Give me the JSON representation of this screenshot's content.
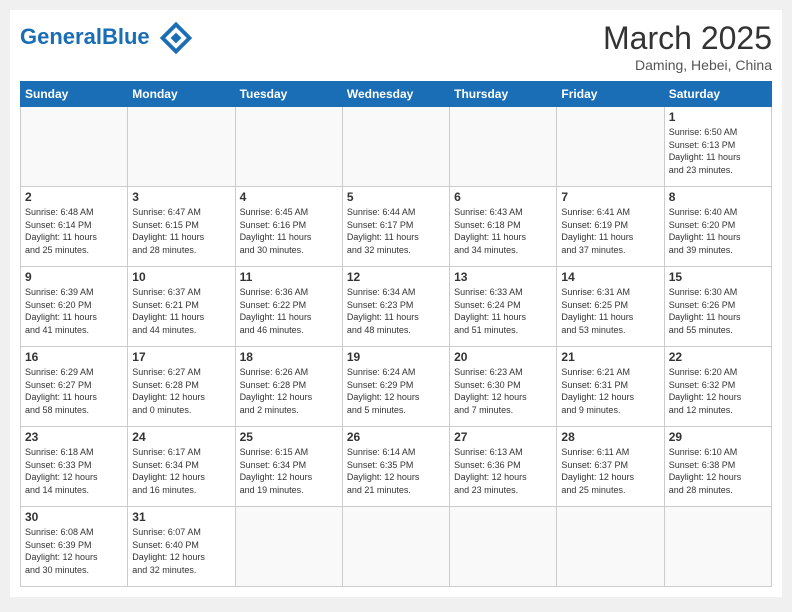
{
  "header": {
    "logo_general": "General",
    "logo_blue": "Blue",
    "month_title": "March 2025",
    "location": "Daming, Hebei, China"
  },
  "weekdays": [
    "Sunday",
    "Monday",
    "Tuesday",
    "Wednesday",
    "Thursday",
    "Friday",
    "Saturday"
  ],
  "weeks": [
    [
      {
        "day": "",
        "info": ""
      },
      {
        "day": "",
        "info": ""
      },
      {
        "day": "",
        "info": ""
      },
      {
        "day": "",
        "info": ""
      },
      {
        "day": "",
        "info": ""
      },
      {
        "day": "",
        "info": ""
      },
      {
        "day": "1",
        "info": "Sunrise: 6:50 AM\nSunset: 6:13 PM\nDaylight: 11 hours\nand 23 minutes."
      }
    ],
    [
      {
        "day": "2",
        "info": "Sunrise: 6:48 AM\nSunset: 6:14 PM\nDaylight: 11 hours\nand 25 minutes."
      },
      {
        "day": "3",
        "info": "Sunrise: 6:47 AM\nSunset: 6:15 PM\nDaylight: 11 hours\nand 28 minutes."
      },
      {
        "day": "4",
        "info": "Sunrise: 6:45 AM\nSunset: 6:16 PM\nDaylight: 11 hours\nand 30 minutes."
      },
      {
        "day": "5",
        "info": "Sunrise: 6:44 AM\nSunset: 6:17 PM\nDaylight: 11 hours\nand 32 minutes."
      },
      {
        "day": "6",
        "info": "Sunrise: 6:43 AM\nSunset: 6:18 PM\nDaylight: 11 hours\nand 34 minutes."
      },
      {
        "day": "7",
        "info": "Sunrise: 6:41 AM\nSunset: 6:19 PM\nDaylight: 11 hours\nand 37 minutes."
      },
      {
        "day": "8",
        "info": "Sunrise: 6:40 AM\nSunset: 6:20 PM\nDaylight: 11 hours\nand 39 minutes."
      }
    ],
    [
      {
        "day": "9",
        "info": "Sunrise: 6:39 AM\nSunset: 6:20 PM\nDaylight: 11 hours\nand 41 minutes."
      },
      {
        "day": "10",
        "info": "Sunrise: 6:37 AM\nSunset: 6:21 PM\nDaylight: 11 hours\nand 44 minutes."
      },
      {
        "day": "11",
        "info": "Sunrise: 6:36 AM\nSunset: 6:22 PM\nDaylight: 11 hours\nand 46 minutes."
      },
      {
        "day": "12",
        "info": "Sunrise: 6:34 AM\nSunset: 6:23 PM\nDaylight: 11 hours\nand 48 minutes."
      },
      {
        "day": "13",
        "info": "Sunrise: 6:33 AM\nSunset: 6:24 PM\nDaylight: 11 hours\nand 51 minutes."
      },
      {
        "day": "14",
        "info": "Sunrise: 6:31 AM\nSunset: 6:25 PM\nDaylight: 11 hours\nand 53 minutes."
      },
      {
        "day": "15",
        "info": "Sunrise: 6:30 AM\nSunset: 6:26 PM\nDaylight: 11 hours\nand 55 minutes."
      }
    ],
    [
      {
        "day": "16",
        "info": "Sunrise: 6:29 AM\nSunset: 6:27 PM\nDaylight: 11 hours\nand 58 minutes."
      },
      {
        "day": "17",
        "info": "Sunrise: 6:27 AM\nSunset: 6:28 PM\nDaylight: 12 hours\nand 0 minutes."
      },
      {
        "day": "18",
        "info": "Sunrise: 6:26 AM\nSunset: 6:28 PM\nDaylight: 12 hours\nand 2 minutes."
      },
      {
        "day": "19",
        "info": "Sunrise: 6:24 AM\nSunset: 6:29 PM\nDaylight: 12 hours\nand 5 minutes."
      },
      {
        "day": "20",
        "info": "Sunrise: 6:23 AM\nSunset: 6:30 PM\nDaylight: 12 hours\nand 7 minutes."
      },
      {
        "day": "21",
        "info": "Sunrise: 6:21 AM\nSunset: 6:31 PM\nDaylight: 12 hours\nand 9 minutes."
      },
      {
        "day": "22",
        "info": "Sunrise: 6:20 AM\nSunset: 6:32 PM\nDaylight: 12 hours\nand 12 minutes."
      }
    ],
    [
      {
        "day": "23",
        "info": "Sunrise: 6:18 AM\nSunset: 6:33 PM\nDaylight: 12 hours\nand 14 minutes."
      },
      {
        "day": "24",
        "info": "Sunrise: 6:17 AM\nSunset: 6:34 PM\nDaylight: 12 hours\nand 16 minutes."
      },
      {
        "day": "25",
        "info": "Sunrise: 6:15 AM\nSunset: 6:34 PM\nDaylight: 12 hours\nand 19 minutes."
      },
      {
        "day": "26",
        "info": "Sunrise: 6:14 AM\nSunset: 6:35 PM\nDaylight: 12 hours\nand 21 minutes."
      },
      {
        "day": "27",
        "info": "Sunrise: 6:13 AM\nSunset: 6:36 PM\nDaylight: 12 hours\nand 23 minutes."
      },
      {
        "day": "28",
        "info": "Sunrise: 6:11 AM\nSunset: 6:37 PM\nDaylight: 12 hours\nand 25 minutes."
      },
      {
        "day": "29",
        "info": "Sunrise: 6:10 AM\nSunset: 6:38 PM\nDaylight: 12 hours\nand 28 minutes."
      }
    ],
    [
      {
        "day": "30",
        "info": "Sunrise: 6:08 AM\nSunset: 6:39 PM\nDaylight: 12 hours\nand 30 minutes."
      },
      {
        "day": "31",
        "info": "Sunrise: 6:07 AM\nSunset: 6:40 PM\nDaylight: 12 hours\nand 32 minutes."
      },
      {
        "day": "",
        "info": ""
      },
      {
        "day": "",
        "info": ""
      },
      {
        "day": "",
        "info": ""
      },
      {
        "day": "",
        "info": ""
      },
      {
        "day": "",
        "info": ""
      }
    ]
  ]
}
